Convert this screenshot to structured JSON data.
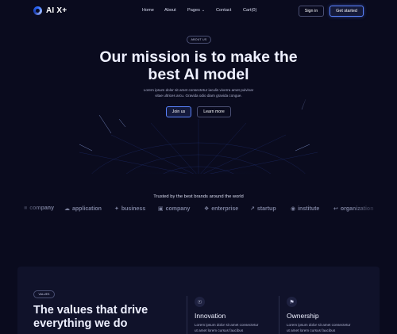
{
  "nav": {
    "logo": "AI X+",
    "links": {
      "home": "Home",
      "about": "About",
      "pages": "Pages",
      "contact": "Contact",
      "cart": "Cart(0)"
    },
    "sign_in": "Sign in",
    "get_started": "Get started"
  },
  "hero": {
    "badge": "ABOUT US",
    "title_line1": "Our mission is to make the",
    "title_line2": "best AI model",
    "subtitle_line1": "Lorem ipsum dolor sit amet consectetur iaculis viverra amet pulvinar",
    "subtitle_line2": "vitae ultrices arcu. Gravida odio diam gravida congue.",
    "join_us": "Join us",
    "learn_more": "Learn more"
  },
  "brands": {
    "heading": "Trusted by the best brands around the world",
    "items": [
      {
        "name": "company",
        "icon": "company-icon"
      },
      {
        "name": "application",
        "icon": "cloud-icon"
      },
      {
        "name": "business",
        "icon": "sparkle-icon"
      },
      {
        "name": "company",
        "icon": "cube-icon"
      },
      {
        "name": "enterprise",
        "icon": "asterisk-icon"
      },
      {
        "name": "startup",
        "icon": "trend-icon"
      },
      {
        "name": "institute",
        "icon": "ring-icon"
      },
      {
        "name": "organization",
        "icon": "hook-icon"
      }
    ]
  },
  "values": {
    "badge": "VALUES",
    "title_line1": "The values that drive",
    "title_line2": "everything we do",
    "features": [
      {
        "icon": "bulb-icon",
        "title": "Innovation",
        "text_line1": "Lorem ipsum dolor sit amet consectetur",
        "text_line2": "ut amet lorem cursus faucibus"
      },
      {
        "icon": "flag-icon",
        "title": "Ownership",
        "text_line1": "Lorem ipsum dolor sit amet consectetur",
        "text_line2": "ut amet lorem cursus faucibus"
      }
    ]
  },
  "colors": {
    "background": "#0a0b1e",
    "accent": "#5a83ff",
    "card": "#10122a"
  }
}
